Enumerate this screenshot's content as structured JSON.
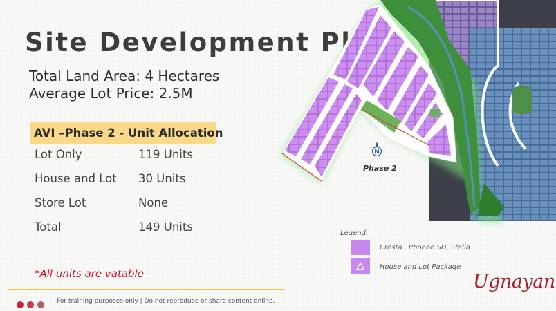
{
  "title": "Site Development Plan",
  "land_area": "Total Land Area: 4 Hectares",
  "lot_price": "Average Lot Price: 2.5M",
  "allocation": {
    "header": "AVI –Phase 2  - Unit Allocation",
    "rows": [
      {
        "label": "Lot Only",
        "value": "119 Units"
      },
      {
        "label": "House and Lot",
        "value": "30 Units"
      },
      {
        "label": "Store Lot",
        "value": "None"
      },
      {
        "label": "Total",
        "value": "149 Units"
      }
    ]
  },
  "vat_note": "*All units are vatable",
  "footer_text": "For training  purposes only | Do not reproduce or share content online.",
  "map": {
    "phase_label": "Phase 2",
    "north_letter": "N",
    "colors": {
      "lot": "#c888ee",
      "green": "#3e8f3c",
      "road": "#ffffff",
      "neighbor_lot": "#4f78a8"
    }
  },
  "legend": {
    "title": "Legend:",
    "items": [
      {
        "label": "Cresta , Phoebe SD, Stella",
        "icon": "lot-swatch"
      },
      {
        "label": "House and Lot Package",
        "icon": "triangle-icon"
      }
    ]
  },
  "logo": "Ugnayan",
  "colors": {
    "title": "#3d3d3d",
    "highlight": "#fbd98a",
    "note_red": "#d0112b",
    "footer_line": "#f0c53c",
    "dots": [
      "#d41f3a",
      "#c9374b",
      "#b55a6a"
    ]
  }
}
